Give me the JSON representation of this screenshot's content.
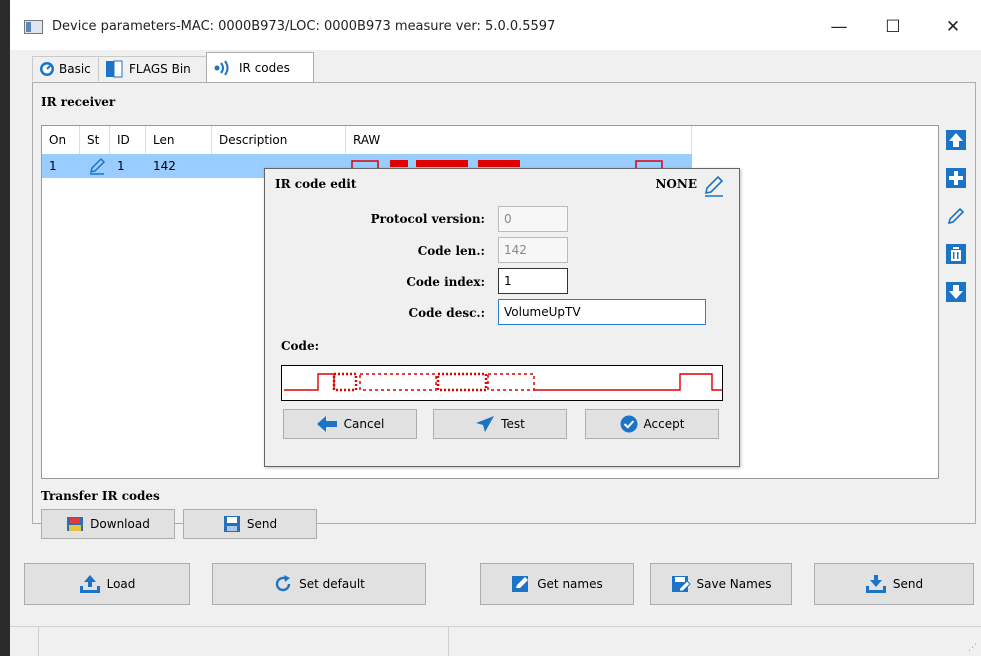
{
  "window": {
    "title": "Device parameters-MAC: 0000B973/LOC: 0000B973 measure ver: 5.0.0.5597",
    "controls": {
      "minimize": "—",
      "maximize": "☐",
      "close": "✕"
    }
  },
  "tabs": [
    {
      "label": "Basic",
      "icon": "gauge-icon"
    },
    {
      "label": "FLAGS Bin",
      "icon": "flag-block-icon"
    },
    {
      "label": "IR codes",
      "icon": "ir-signal-icon",
      "active": true
    }
  ],
  "ir_receiver": {
    "heading": "IR receiver",
    "columns": [
      "On",
      "St",
      "ID",
      "Len",
      "Description",
      "RAW"
    ],
    "rows": [
      {
        "on": "1",
        "st_icon": "pencil-icon",
        "id": "1",
        "len": "142",
        "description": ""
      }
    ]
  },
  "side_buttons": [
    "arrow-up-icon",
    "plus-icon",
    "pencil-icon",
    "delete-icon",
    "arrow-down-icon"
  ],
  "transfer": {
    "heading": "Transfer IR codes",
    "download_label": "Download",
    "send_label": "Send"
  },
  "bottom_buttons": {
    "load": "Load",
    "set_default": "Set default",
    "get_names": "Get names",
    "save_names": "Save Names",
    "send": "Send"
  },
  "dialog": {
    "title": "IR code edit",
    "state": "NONE",
    "fields": {
      "protocol_version_label": "Protocol version:",
      "protocol_version_value": "0",
      "code_len_label": "Code len.:",
      "code_len_value": "142",
      "code_index_label": "Code index:",
      "code_index_value": "1",
      "code_desc_label": "Code desc.:",
      "code_desc_value": "VolumeUpTV"
    },
    "code_label": "Code:",
    "buttons": {
      "cancel": "Cancel",
      "test": "Test",
      "accept": "Accept"
    }
  },
  "colors": {
    "selection": "#99ccff",
    "signal": "#e00000",
    "accent": "#1b74c5"
  }
}
